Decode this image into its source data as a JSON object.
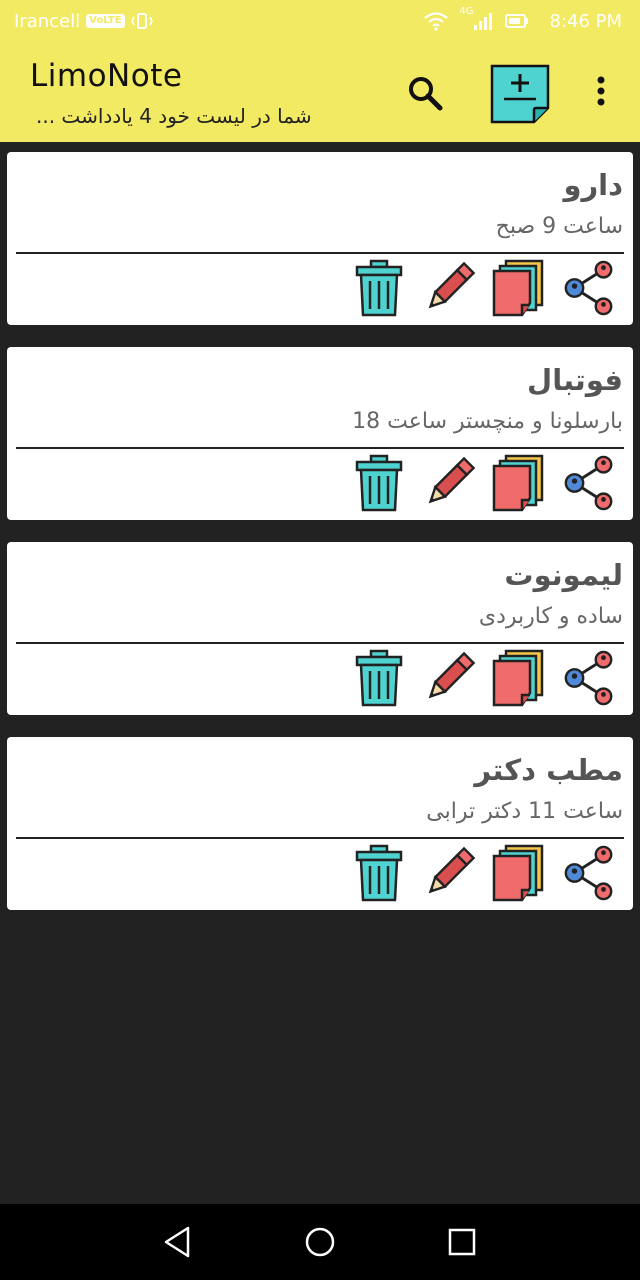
{
  "status_bar": {
    "carrier": "Irancell",
    "volte": "VoLTE",
    "network": "4G",
    "time": "8:46 PM"
  },
  "toolbar": {
    "title": "LimoNote",
    "subtitle": "شما در لیست خود 4 یادداشت ...",
    "accent_color": "#f3ea63"
  },
  "notes": [
    {
      "title": "دارو",
      "body": "ساعت 9 صبح"
    },
    {
      "title": "فوتبال",
      "body": "بارسلونا و منچستر  ساعت 18"
    },
    {
      "title": "لیمونوت",
      "body": "ساده و کاربردی"
    },
    {
      "title": "مطب دکتر",
      "body": "ساعت 11 دکتر ترابی"
    }
  ],
  "note_actions": [
    "share-icon",
    "copy-icon",
    "edit-icon",
    "delete-icon"
  ],
  "nav": [
    "back-icon",
    "home-icon",
    "recents-icon"
  ]
}
